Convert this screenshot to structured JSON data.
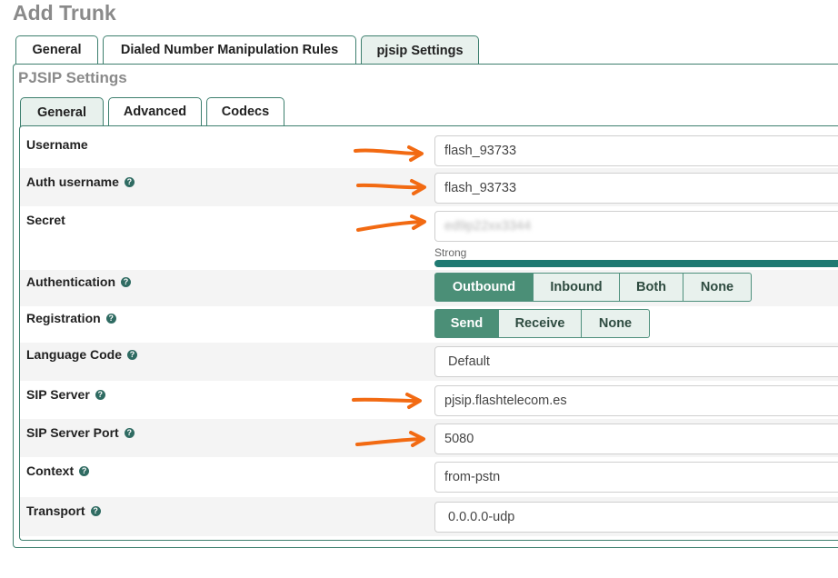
{
  "page": {
    "title": "Add Trunk"
  },
  "top_tabs": [
    "General",
    "Dialed Number Manipulation Rules",
    "pjsip Settings"
  ],
  "section": {
    "title": "PJSIP Settings"
  },
  "inner_tabs": [
    "General",
    "Advanced",
    "Codecs"
  ],
  "fields": {
    "username": {
      "label": "Username",
      "value": "flash_93733"
    },
    "auth_username": {
      "label": "Auth username",
      "value": "flash_93733"
    },
    "secret": {
      "label": "Secret",
      "value": "ed9p22xx3344",
      "strength": "Strong"
    },
    "authentication": {
      "label": "Authentication",
      "options": [
        "Outbound",
        "Inbound",
        "Both",
        "None"
      ],
      "selected": "Outbound"
    },
    "registration": {
      "label": "Registration",
      "options": [
        "Send",
        "Receive",
        "None"
      ],
      "selected": "Send"
    },
    "language_code": {
      "label": "Language Code",
      "value": "Default"
    },
    "sip_server": {
      "label": "SIP Server",
      "value": "pjsip.flashtelecom.es"
    },
    "sip_server_port": {
      "label": "SIP Server Port",
      "value": "5080"
    },
    "context": {
      "label": "Context",
      "value": "from-pstn"
    },
    "transport": {
      "label": "Transport",
      "value": "0.0.0.0-udp"
    }
  },
  "colors": {
    "accent": "#3d7f6e",
    "active_button": "#4b8f77",
    "annotation_arrow": "#f26a12",
    "strength_bar": "#1f7a72"
  },
  "icons": {
    "help": "question-circle-icon",
    "annotation": "arrow-right-icon"
  }
}
